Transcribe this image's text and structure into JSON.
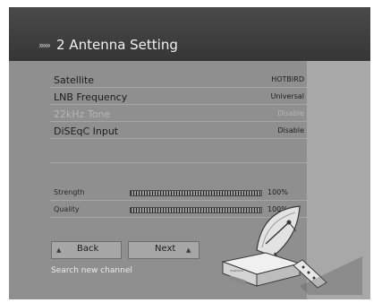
{
  "header": {
    "chevrons": "›››››",
    "title": "2 Antenna Setting"
  },
  "settings": [
    {
      "label": "Satellite",
      "value": "HOTBIRD"
    },
    {
      "label": "LNB Frequency",
      "value": "Universal"
    },
    {
      "label": "22kHz Tone",
      "value": "Disable"
    },
    {
      "label": "DiSEqC Input",
      "value": "Disable"
    }
  ],
  "signal": {
    "strength": {
      "label": "Strength",
      "percent_text": "100%",
      "level": 1.0
    },
    "quality": {
      "label": "Quality",
      "percent_text": "100%",
      "level": 1.0
    }
  },
  "buttons": {
    "back": {
      "label": "Back",
      "arrow": "▲"
    },
    "next": {
      "label": "Next",
      "arrow": "▲"
    }
  },
  "status_text": "Search new channel",
  "illustration": {
    "device_label": "▭▭▭▭"
  }
}
